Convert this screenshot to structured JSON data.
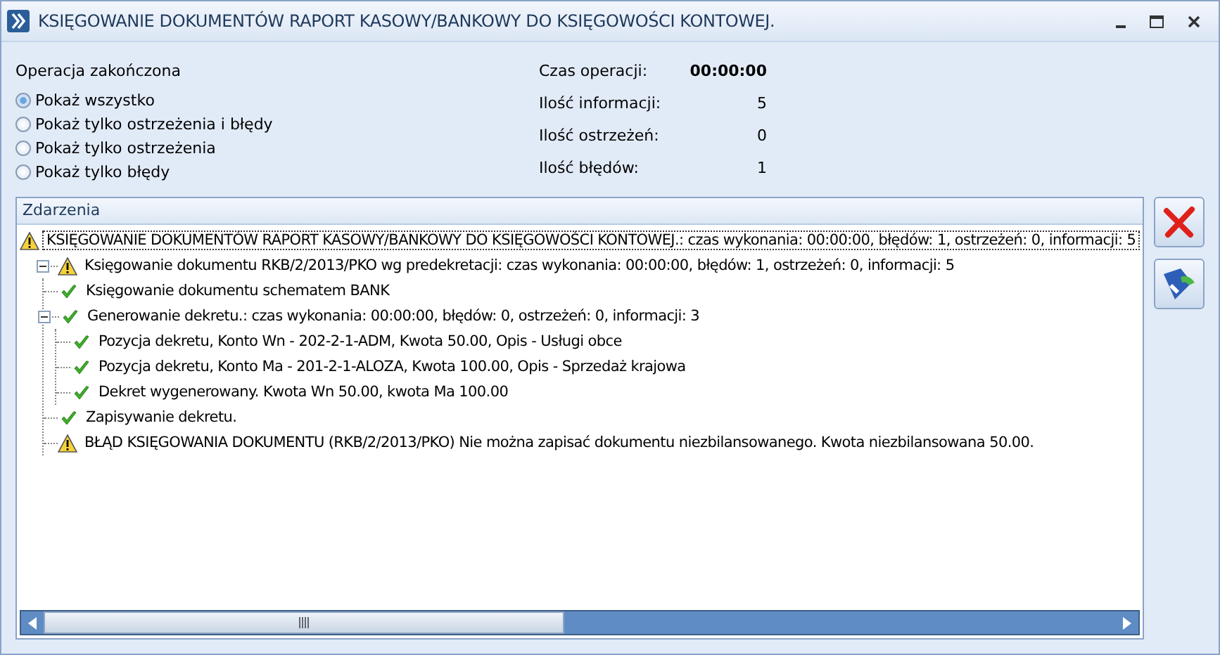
{
  "window": {
    "title": "KSIĘGOWANIE DOKUMENTÓW RAPORT KASOWY/BANKOWY DO KSIĘGOWOŚCI KONTOWEJ."
  },
  "filter": {
    "title": "Operacja zakończona",
    "options": [
      {
        "label": "Pokaż wszystko",
        "selected": true
      },
      {
        "label": "Pokaż tylko ostrzeżenia i błędy",
        "selected": false
      },
      {
        "label": "Pokaż tylko ostrzeżenia",
        "selected": false
      },
      {
        "label": "Pokaż tylko błędy",
        "selected": false
      }
    ]
  },
  "stats": [
    {
      "label": "Czas operacji:",
      "value": "00:00:00",
      "kind": "time"
    },
    {
      "label": "Ilość informacji:",
      "value": "5",
      "kind": "count"
    },
    {
      "label": "Ilość ostrzeżeń:",
      "value": "0",
      "kind": "count"
    },
    {
      "label": "Ilość błędów:",
      "value": "1",
      "kind": "count"
    }
  ],
  "events": {
    "header": "Zdarzenia",
    "items": [
      {
        "label": "KSIĘGOWANIE DOKUMENTÓW RAPORT KASOWY/BANKOWY DO KSIĘGOWOŚCI KONTOWEJ.: czas wykonania: 00:00:00, błędów: 1, ostrzeżeń: 0, informacji: 5",
        "kind": "warning",
        "selected": true
      },
      {
        "label": "Księgowanie dokumentu RKB/2/2013/PKO wg predekretacji: czas wykonania: 00:00:00, błędów: 1, ostrzeżeń: 0, informacji: 5",
        "kind": "warning",
        "selected": false,
        "expanded": true,
        "children": [
          {
            "label": "Księgowanie dokumentu schematem BANK",
            "kind": "ok",
            "selected": false
          },
          {
            "label": "Generowanie dekretu.: czas wykonania: 00:00:00, błędów: 0, ostrzeżeń: 0, informacji: 3",
            "kind": "ok",
            "selected": false,
            "expanded": true,
            "children": [
              {
                "label": "Pozycja dekretu, Konto Wn - 202-2-1-ADM, Kwota 50.00, Opis - Usługi obce",
                "kind": "ok",
                "selected": false
              },
              {
                "label": "Pozycja dekretu, Konto Ma - 201-2-1-ALOZA, Kwota 100.00, Opis - Sprzedaż krajowa",
                "kind": "ok",
                "selected": false
              },
              {
                "label": "Dekret wygenerowany. Kwota Wn 50.00, kwota Ma 100.00",
                "kind": "ok",
                "selected": false
              }
            ]
          },
          {
            "label": "Zapisywanie dekretu.",
            "kind": "ok",
            "selected": false
          },
          {
            "label": "BŁĄD KSIĘGOWANIA DOKUMENTU (RKB/2/2013/PKO) Nie można zapisać dokumentu niezbilansowanego. Kwota niezbilansowana 50.00.",
            "kind": "warning",
            "selected": false
          }
        ]
      }
    ]
  }
}
